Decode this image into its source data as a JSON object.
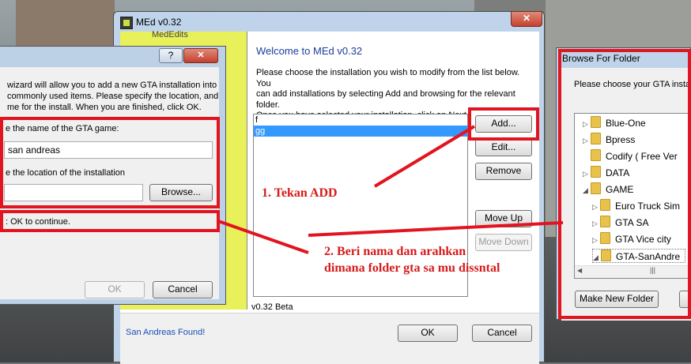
{
  "med": {
    "title": "MEd v0.32",
    "left_tab_fragment": "MedEdits",
    "heading": "Welcome to MEd v0.32",
    "instructions": [
      "Please choose the installation you wish to modify from the list below. You",
      "can add installations by selecting Add and browsing for the relevant",
      "folder.",
      "Once you have selected your installation, click on Next."
    ],
    "installations": [
      "f",
      "gg"
    ],
    "selected_index": 1,
    "buttons": {
      "add": "Add...",
      "edit": "Edit...",
      "remove": "Remove",
      "move_up": "Move Up",
      "move_down": "Move Down"
    },
    "version": "v0.32 Beta",
    "status": "San Andreas Found!",
    "ok": "OK",
    "cancel": "Cancel"
  },
  "wizard": {
    "help_glyph": "?",
    "close_glyph": "✕",
    "intro": [
      "wizard will allow you to add a new GTA installation into",
      "commonly used items. Please specify the location, and",
      "me for the install. When you are finished, click OK."
    ],
    "name_label": "e the name of the GTA game:",
    "name_value": "san andreas",
    "location_label": "e the location of the installation",
    "location_value": "",
    "browse": "Browse...",
    "hint": ": OK to continue.",
    "ok": "OK",
    "cancel": "Cancel"
  },
  "browse": {
    "title": "Browse For Folder",
    "prompt": "Please choose your GTA installa",
    "tree": [
      {
        "label": "Blue-One",
        "arrow": "▷",
        "indent": 0
      },
      {
        "label": "Bpress",
        "arrow": "▷",
        "indent": 0
      },
      {
        "label": "Codify ( Free Ver",
        "arrow": "",
        "indent": 0
      },
      {
        "label": "DATA",
        "arrow": "▷",
        "indent": 0
      },
      {
        "label": "GAME",
        "arrow": "◢",
        "indent": 0
      },
      {
        "label": "Euro Truck Sim",
        "arrow": "▷",
        "indent": 1
      },
      {
        "label": "GTA SA",
        "arrow": "▷",
        "indent": 1
      },
      {
        "label": "GTA Vice city",
        "arrow": "▷",
        "indent": 1
      },
      {
        "label": "GTA-SanAndre",
        "arrow": "◢",
        "indent": 1
      }
    ],
    "make_new_folder": "Make New Folder"
  },
  "annotations": {
    "step1": "1. Tekan ADD",
    "step2_line1": "2. Beri nama dan arahkan",
    "step2_line2": "dimana folder gta sa mu dissntal"
  },
  "colors": {
    "annotation_red": "#e2141f",
    "selection_blue": "#3399ff",
    "heading_blue": "#1a3e9a",
    "status_blue": "#1c4eb5"
  }
}
